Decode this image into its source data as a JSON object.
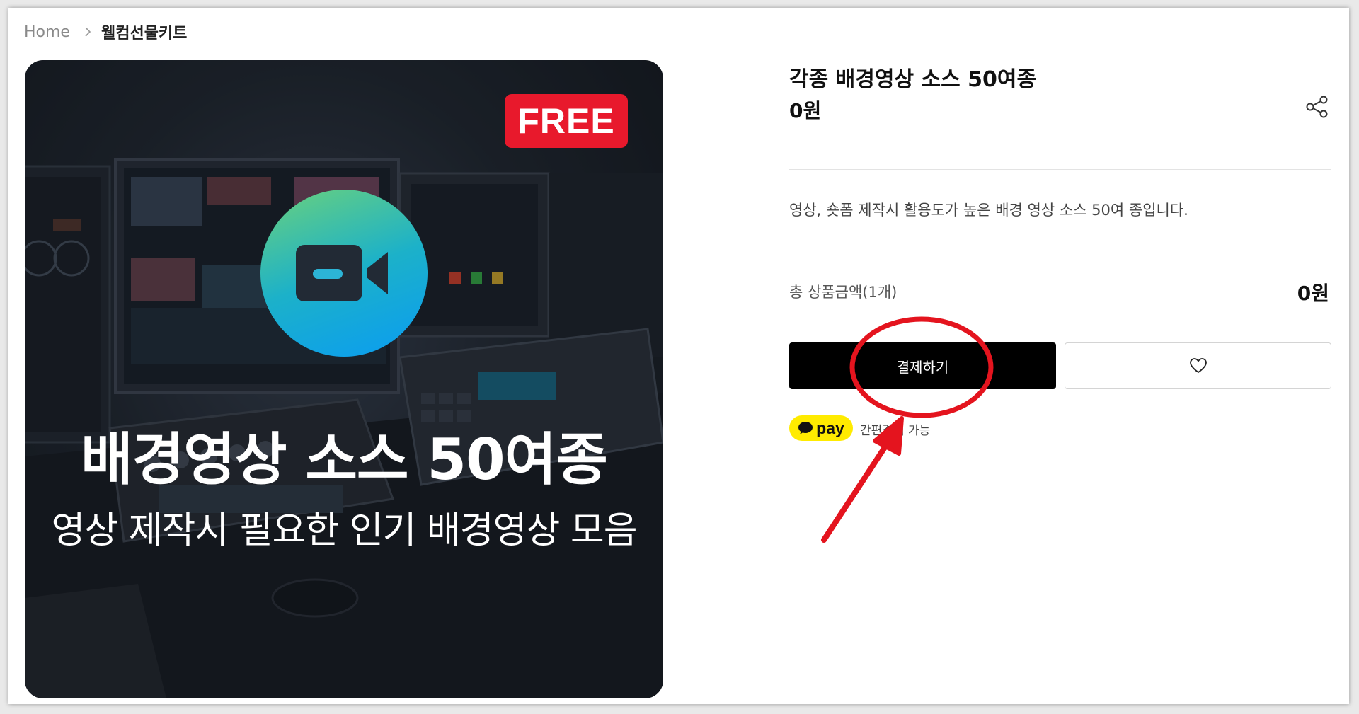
{
  "breadcrumb": {
    "home": "Home",
    "current": "웰컴선물키트"
  },
  "image": {
    "badge": "FREE",
    "headline": "배경영상 소스 50여종",
    "subline": "영상 제작시 필요한 인기 배경영상 모음",
    "badge_color": "#e8192c"
  },
  "product": {
    "title": "각종 배경영상 소스 50여종",
    "price": "0원",
    "description": "영상, 숏폼 제작시 활용도가 높은 배경 영상 소스 50여 종입니다."
  },
  "total": {
    "label": "총 상품금액(1개)",
    "value": "0원"
  },
  "buttons": {
    "checkout_label": "결제하기",
    "wishlist_icon": "heart-icon",
    "share_icon": "share-icon"
  },
  "payment": {
    "kakaopay_label": "pay",
    "note": "간편결제 가능",
    "kakaopay_color": "#ffeb00"
  },
  "annotation": {
    "color": "#e4141e",
    "shapes": [
      "circle",
      "arrow"
    ]
  }
}
